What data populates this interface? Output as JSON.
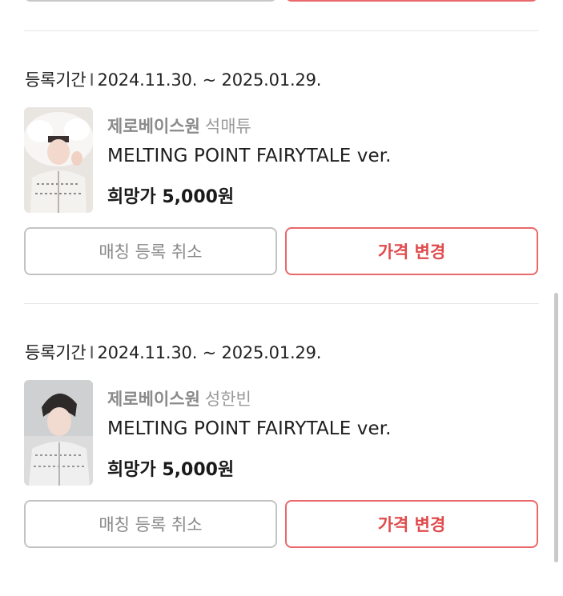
{
  "listings": [
    {
      "period_label": "등록기간",
      "period_sep": "I",
      "period_value": "2024.11.30. ~ 2025.01.29.",
      "group": "제로베이스원",
      "member": "석매튜",
      "album": "MELTING POINT FAIRYTALE ver.",
      "price": "희망가 5,000원",
      "cancel_label": "매칭 등록 취소",
      "change_label": "가격 변경"
    },
    {
      "period_label": "등록기간",
      "period_sep": "I",
      "period_value": "2024.11.30. ~ 2025.01.29.",
      "group": "제로베이스원",
      "member": "성한빈",
      "album": "MELTING POINT FAIRYTALE ver.",
      "price": "희망가 5,000원",
      "cancel_label": "매칭 등록 취소",
      "change_label": "가격 변경"
    }
  ],
  "colors": {
    "accent": "#e04a4c",
    "accent_border": "#e9686a",
    "muted": "#888888"
  }
}
